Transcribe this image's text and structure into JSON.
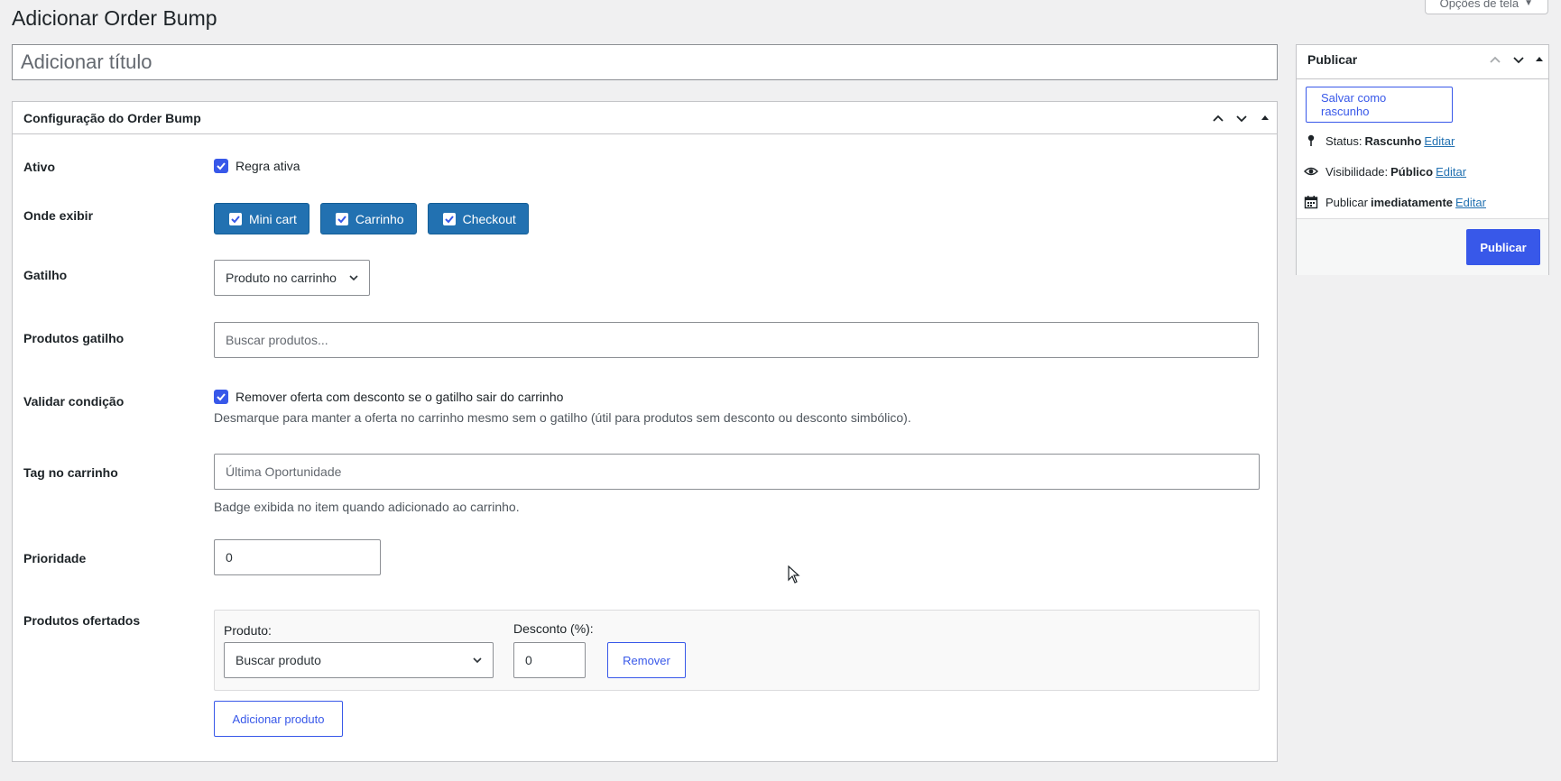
{
  "screen_options": {
    "label": "Opções de tela"
  },
  "page": {
    "title": "Adicionar Order Bump"
  },
  "title_field": {
    "placeholder": "Adicionar título"
  },
  "config": {
    "heading": "Configuração do Order Bump",
    "ativo": {
      "label": "Ativo",
      "checkbox_label": "Regra ativa"
    },
    "onde_exibir": {
      "label": "Onde exibir",
      "options": [
        "Mini cart",
        "Carrinho",
        "Checkout"
      ]
    },
    "gatilho": {
      "label": "Gatilho",
      "value": "Produto no carrinho"
    },
    "produtos_gatilho": {
      "label": "Produtos gatilho",
      "placeholder": "Buscar produtos..."
    },
    "validar": {
      "label": "Validar condição",
      "checkbox_label": "Remover oferta com desconto se o gatilho sair do carrinho",
      "help": "Desmarque para manter a oferta no carrinho mesmo sem o gatilho (útil para produtos sem desconto ou desconto simbólico)."
    },
    "tag": {
      "label": "Tag no carrinho",
      "placeholder": "Última Oportunidade",
      "help": "Badge exibida no item quando adicionado ao carrinho."
    },
    "prioridade": {
      "label": "Prioridade",
      "value": "0"
    },
    "ofertados": {
      "label": "Produtos ofertados",
      "produto_label": "Produto:",
      "produto_value": "Buscar produto",
      "desconto_label": "Desconto (%):",
      "desconto_value": "0",
      "remove_label": "Remover",
      "add_label": "Adicionar produto"
    }
  },
  "publish": {
    "heading": "Publicar",
    "save_draft": "Salvar como rascunho",
    "status_label": "Status:",
    "status_value": "Rascunho",
    "visibility_label": "Visibilidade:",
    "visibility_value": "Público",
    "schedule_label": "Publicar",
    "schedule_value": "imediatamente",
    "edit_label": "Editar",
    "publish_button": "Publicar"
  },
  "colors": {
    "accent": "#3858e9",
    "pill": "#2271b1",
    "link": "#2271b1"
  }
}
